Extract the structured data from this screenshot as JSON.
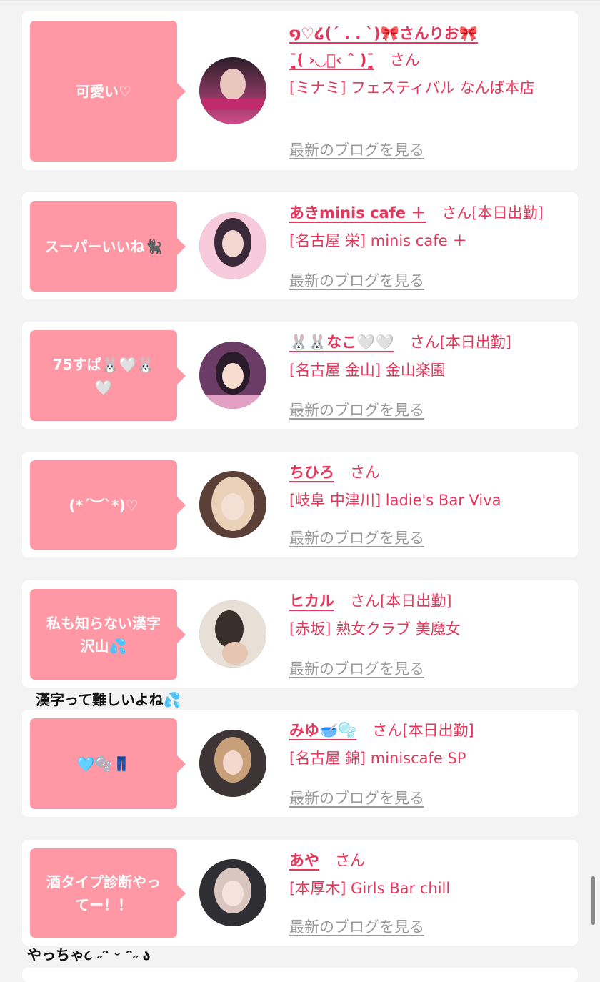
{
  "entries": [
    {
      "comment": "可愛い♡",
      "name_line1": "໑♡໒(ˊ . . ˋ)🎀さんりお🎀",
      "name_line2": "ˉ̞̭( ›◡ु‹ ˆ )ˉ̞̭",
      "san": "さん",
      "status": "",
      "shop": "[ミナミ] フェスティバル なんば本店",
      "blog": "最新のブログを見る",
      "avatar": {
        "c1": "#2c1f2a",
        "c2": "#d04a8a"
      }
    },
    {
      "comment": "スーパーいいね🐈‍⬛",
      "name_line1": "あきminis cafe ＋",
      "name_line2": "",
      "san": "さん",
      "status": "[本日出勤]",
      "shop": "[名古屋 栄] minis cafe ＋",
      "blog": "最新のブログを見る",
      "avatar": {
        "c1": "#f6c9db",
        "c2": "#3a2a3a"
      }
    },
    {
      "comment": "75すぱ🐰🤍🐰\n🤍",
      "name_line1": "🐰🐰なこ🤍🤍",
      "name_line2": "",
      "san": "さん",
      "status": "[本日出勤]",
      "shop": "[名古屋 金山] 金山楽園",
      "blog": "最新のブログを見る",
      "avatar": {
        "c1": "#6b3d66",
        "c2": "#e3a0c5"
      }
    },
    {
      "comment": "(*´︶`*)♡",
      "name_line1": "ちひろ",
      "name_line2": "",
      "san": "さん",
      "status": "",
      "shop": "[岐阜 中津川] ladie's Bar Viva",
      "blog": "最新のブログを見る",
      "avatar": {
        "c1": "#e9d2b8",
        "c2": "#5a4036"
      }
    },
    {
      "comment": "私も知らない漢字\n沢山💦",
      "name_line1": "ヒカル",
      "name_line2": "",
      "san": "さん",
      "status": "[本日出勤]",
      "shop": "[赤坂] 熟女クラブ 美魔女",
      "blog": "最新のブログを見る",
      "avatar": {
        "c1": "#e8e0d6",
        "c2": "#3a302b"
      }
    },
    {
      "comment": "🩵🫧👖",
      "name_line1": "みゆ🥣🫧",
      "name_line2": "",
      "san": "さん",
      "status": "[本日出勤]",
      "shop": "[名古屋 錦] miniscafe SP",
      "blog": "最新のブログを見る",
      "avatar": {
        "c1": "#3d3535",
        "c2": "#c7a07a"
      }
    },
    {
      "comment": "酒タイプ診断やっ\nてー！！",
      "name_line1": "あや",
      "name_line2": "",
      "san": "さん",
      "status": "",
      "shop": "[本厚木] Girls Bar chill",
      "blog": "最新のブログを見る",
      "avatar": {
        "c1": "#2e2e33",
        "c2": "#d9c6c0"
      }
    }
  ],
  "notes": {
    "note1": "漢字って難しいよね💦",
    "note2": "やっちゃ૮ ˶ᵔ ᵕ ᵔ˶ ა"
  },
  "colors": {
    "bubble": "#ff97a5",
    "accent": "#e5375c",
    "link_gray": "#9a9a9a",
    "background": "#f3f3f3"
  }
}
